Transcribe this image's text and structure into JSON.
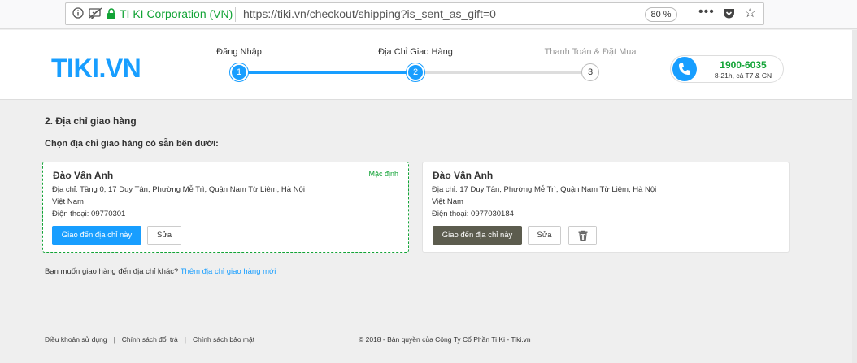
{
  "browser": {
    "company": "TI KI Corporation (VN)",
    "url": "https://tiki.vn/checkout/shipping?is_sent_as_gift=0",
    "zoom": "80 %",
    "more": "•••",
    "info_icon": "info-icon",
    "permissions_icon": "permissions-icon",
    "lock_icon": "lock-icon",
    "pocket_icon": "pocket-icon",
    "bookmark_icon": "star-icon"
  },
  "header": {
    "logo": "TIKI.VN",
    "steps": [
      {
        "label": "Đăng Nhập",
        "number": "1",
        "status": "done"
      },
      {
        "label": "Địa Chỉ Giao Hàng",
        "number": "2",
        "status": "current"
      },
      {
        "label": "Thanh Toán & Đặt Mua",
        "number": "3",
        "status": "pending"
      }
    ],
    "hotline": {
      "number": "1900-6035",
      "hours": "8-21h, cả T7 & CN",
      "icon": "phone-icon"
    }
  },
  "main": {
    "title": "2. Địa chỉ giao hàng",
    "subtitle": "Chọn địa chỉ giao hàng có sẵn bên dưới:",
    "addresses": [
      {
        "name": "Đào Vân Anh",
        "default_label": "Mặc định",
        "address": "Địa chỉ: Tầng 0, 17 Duy Tân, Phường Mễ Trì, Quận Nam Từ Liêm, Hà Nội",
        "country": "Việt Nam",
        "phone": "Điện thoại: 09770301",
        "ship_button": "Giao đến địa chỉ này",
        "edit_button": "Sửa"
      },
      {
        "name": "Đào Vân Anh",
        "address": "Địa chỉ: 17 Duy Tân, Phường Mễ Trì, Quận Nam Từ Liêm, Hà Nội",
        "country": "Việt Nam",
        "phone": "Điện thoại: 0977030184",
        "ship_button": "Giao đến địa chỉ này",
        "edit_button": "Sửa",
        "delete_icon": "trash-icon"
      }
    ],
    "other_address_prompt": "Bạn muốn giao hàng đến địa chỉ khác?",
    "other_address_link": "Thêm địa chỉ giao hàng mới"
  },
  "footer": {
    "links": [
      "Điều khoản sử dụng",
      "Chính sách đổi trả",
      "Chính sách bảo mật"
    ],
    "separator": "|",
    "copyright": "© 2018 - Bản quyền của Công Ty Cổ Phần Ti Ki - Tiki.vn"
  },
  "colors": {
    "accent": "#189eff",
    "green": "#12a336",
    "dark_button": "#5c5c4e"
  }
}
